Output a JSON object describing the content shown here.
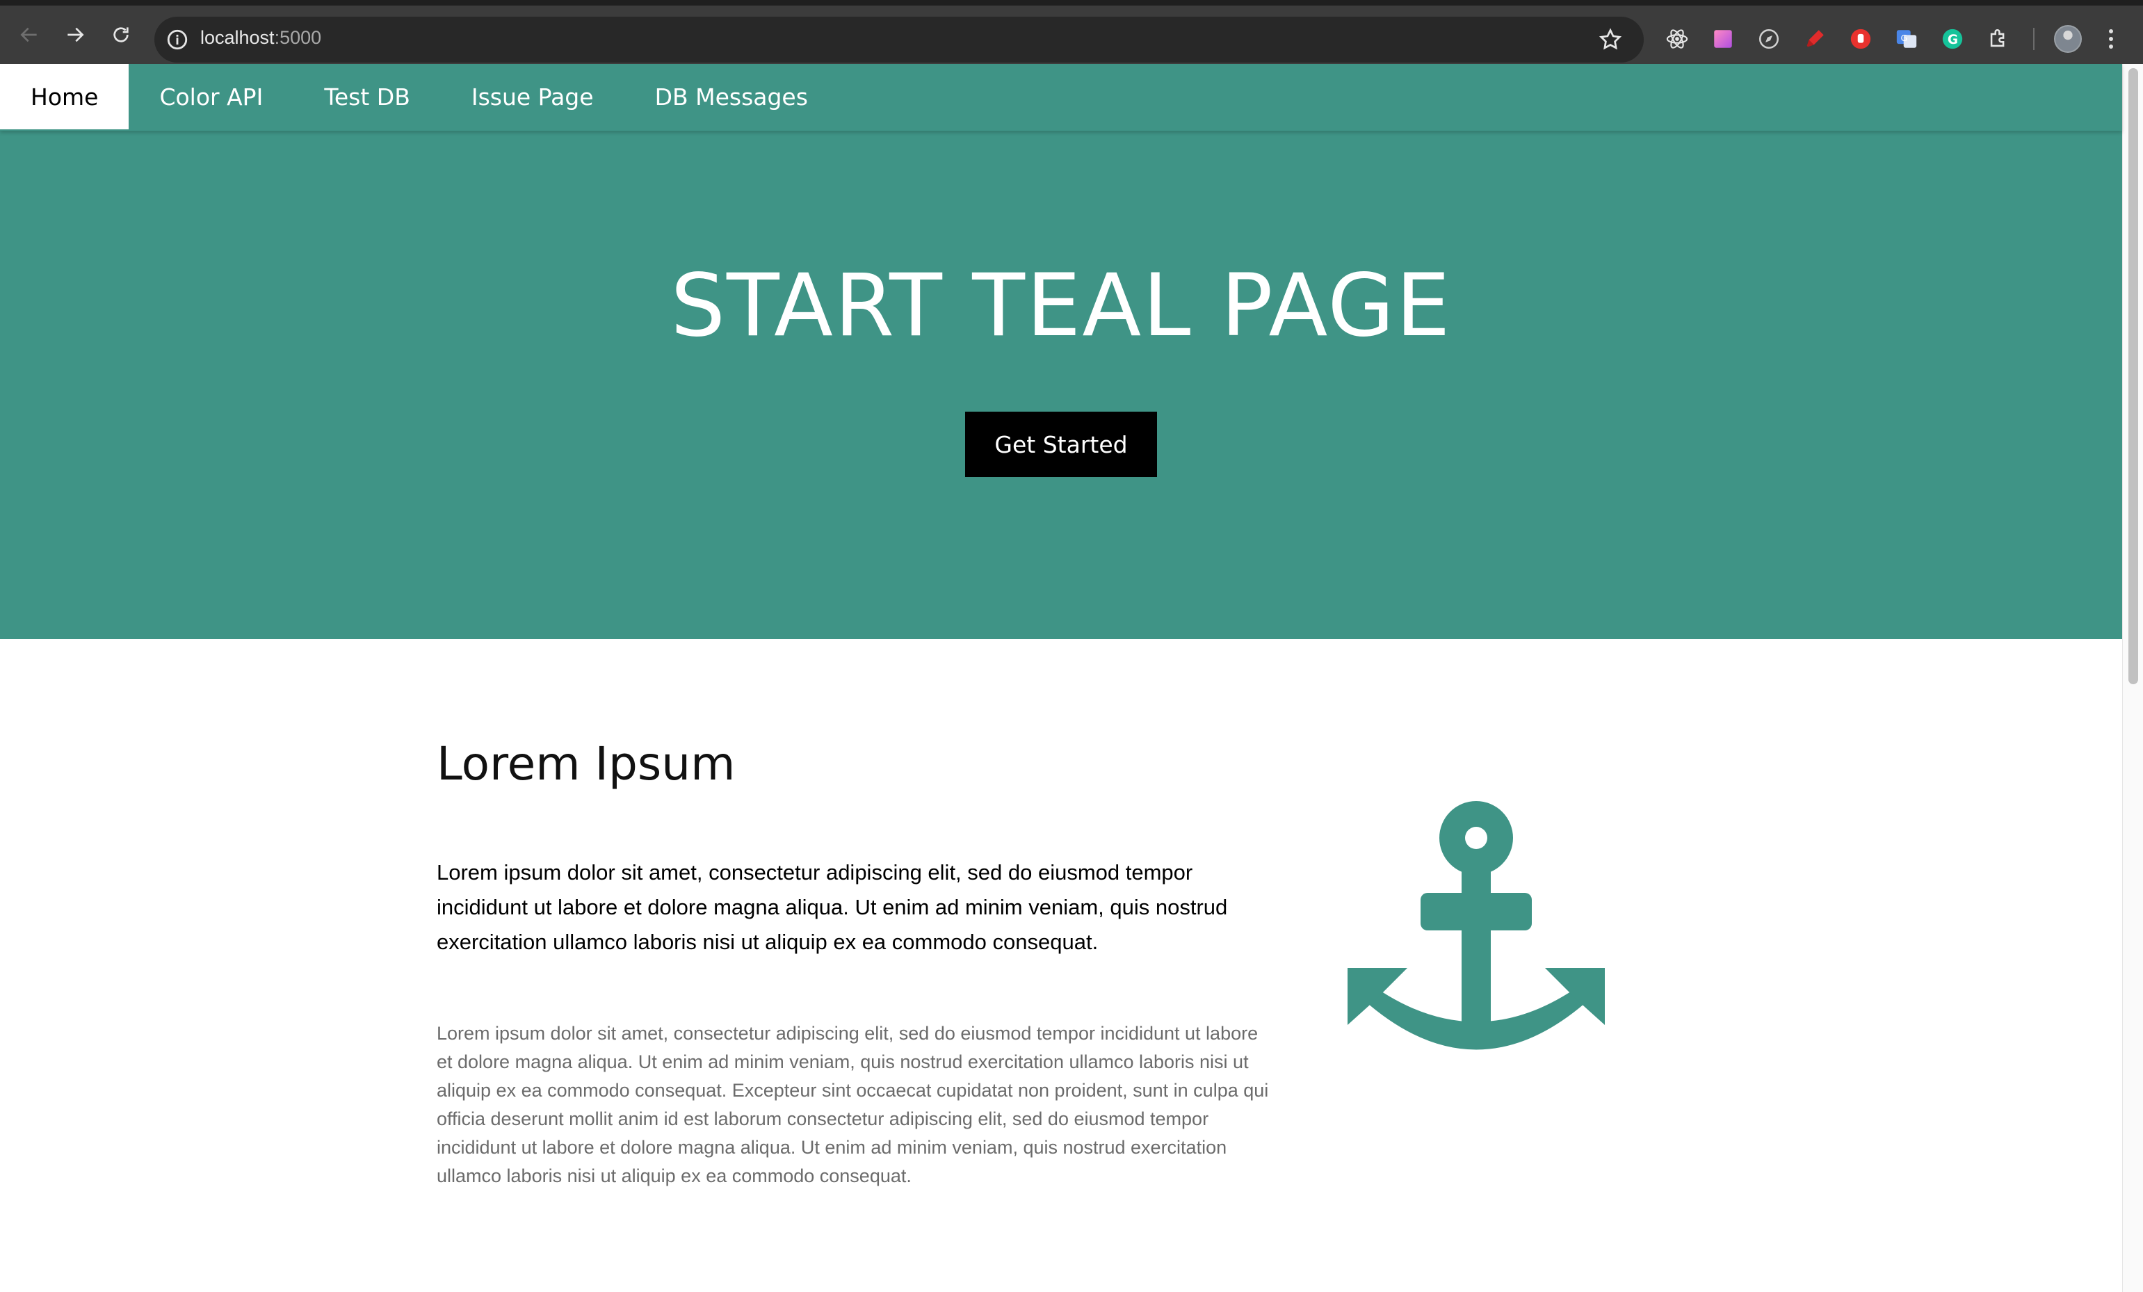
{
  "browser": {
    "url_host": "localhost",
    "url_port": ":5000"
  },
  "nav": {
    "items": [
      {
        "label": "Home",
        "active": true
      },
      {
        "label": "Color API"
      },
      {
        "label": "Test DB"
      },
      {
        "label": "Issue Page"
      },
      {
        "label": "DB Messages"
      }
    ]
  },
  "hero": {
    "title": "START TEAL PAGE",
    "button_label": "Get Started"
  },
  "content": {
    "title": "Lorem Ipsum",
    "lead": "Lorem ipsum dolor sit amet, consectetur adipiscing elit, sed do eiusmod tempor incididunt ut labore et dolore magna aliqua. Ut enim ad minim veniam, quis nostrud exercitation ullamco laboris nisi ut aliquip ex ea commodo consequat.",
    "body": "Lorem ipsum dolor sit amet, consectetur adipiscing elit, sed do eiusmod tempor incididunt ut labore et dolore magna aliqua. Ut enim ad minim veniam, quis nostrud exercitation ullamco laboris nisi ut aliquip ex ea commodo consequat. Excepteur sint occaecat cupidatat non proident, sunt in culpa qui officia deserunt mollit anim id est laborum consectetur adipiscing elit, sed do eiusmod tempor incididunt ut labore et dolore magna aliqua. Ut enim ad minim veniam, quis nostrud exercitation ullamco laboris nisi ut aliquip ex ea commodo consequat.",
    "icon": "anchor-icon"
  },
  "colors": {
    "teal": "#3f9486",
    "button_bg": "#000000",
    "body_text": "#6b6b6b"
  }
}
